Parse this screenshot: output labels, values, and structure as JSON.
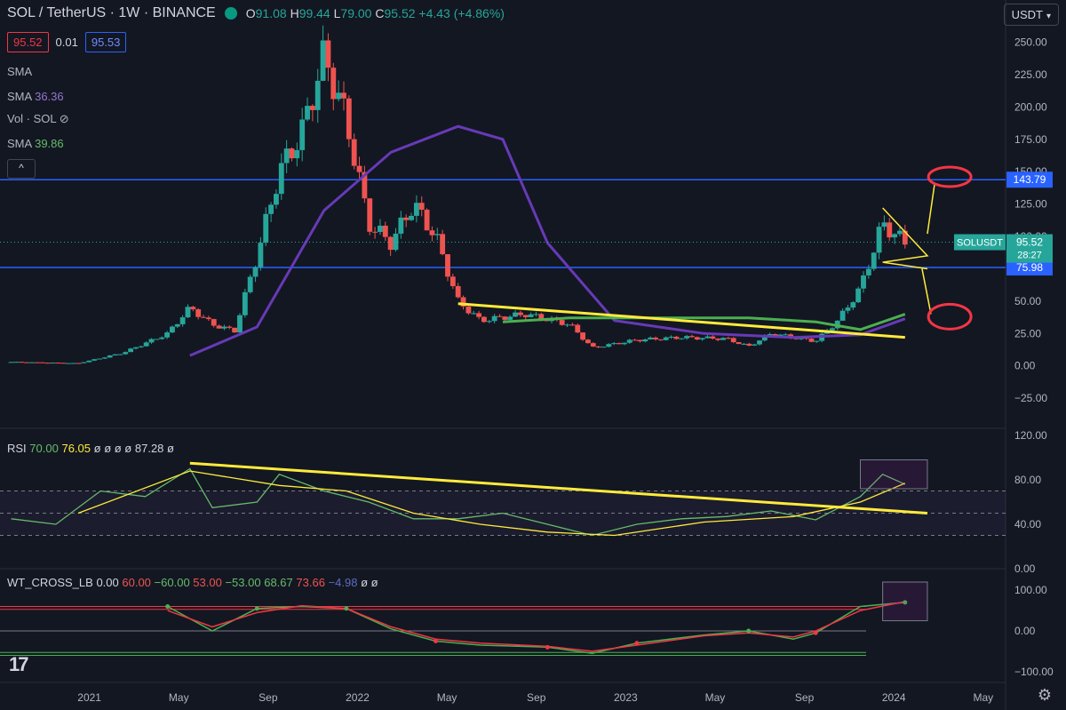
{
  "header": {
    "symbol": "SOL / TetherUS · 1W · BINANCE",
    "open_label": "O",
    "open": "91.08",
    "high_label": "H",
    "high": "99.44",
    "low_label": "L",
    "low": "79.00",
    "close_label": "C",
    "close": "95.52",
    "change": "+4.43 (+4.86%)"
  },
  "bid": "95.52",
  "spread": "0.01",
  "ask": "95.53",
  "currency": "USDT",
  "indicators": {
    "sma1_label": "SMA",
    "sma2_label": "SMA",
    "sma2_value": "36.36",
    "vol_label": "Vol · SOL",
    "sma3_label": "SMA",
    "sma3_value": "39.86",
    "collapse_glyph": "^"
  },
  "rsi_label": {
    "name": "RSI",
    "v1": "70.00",
    "v2": "76.05",
    "v3": "ø ø ø ø",
    "v4": "87.28",
    "v5": "ø"
  },
  "wt_label": {
    "name": "WT_CROSS_LB",
    "v1": "0.00",
    "v2": "60.00",
    "v3": "−60.00",
    "v4": "53.00",
    "v5": "−53.00",
    "v6": "68.67",
    "v7": "73.66",
    "v8": "−4.98",
    "v9": "ø ø"
  },
  "logo": "17",
  "colors": {
    "bg": "#131722",
    "up": "#26a69a",
    "down": "#ef5350",
    "level": "#2962ff",
    "sma_fast": "#673ab7",
    "sma_slow": "#4caf50",
    "trend": "#ffeb3b",
    "price_tag": "#26a69a"
  },
  "chart_data": [
    {
      "type": "candlestick",
      "title": "SOL / TetherUS · 1W · BINANCE",
      "y_ticks": [
        250,
        225,
        200,
        175,
        150,
        125,
        100,
        75,
        50,
        25,
        0,
        -25
      ],
      "y_tick_labels": [
        "250.00",
        "225.00",
        "200.00",
        "175.00",
        "150.00",
        "125.00",
        "100.00",
        "75.00",
        "50.00",
        "25.00",
        "0.00",
        "−25.00"
      ],
      "ylim": [
        -40,
        262
      ],
      "x_ticks": [
        "2021",
        "May",
        "Sep",
        "2022",
        "May",
        "Sep",
        "2023",
        "May",
        "Sep",
        "2024",
        "May"
      ],
      "x_range": [
        "2020-09",
        "2024-06"
      ],
      "price_points": [
        [
          "2020-09",
          3
        ],
        [
          "2020-12",
          2
        ],
        [
          "2021-02",
          10
        ],
        [
          "2021-04",
          25
        ],
        [
          "2021-05",
          45
        ],
        [
          "2021-06",
          32
        ],
        [
          "2021-07",
          27
        ],
        [
          "2021-08",
          85
        ],
        [
          "2021-09",
          150
        ],
        [
          "2021-10",
          180
        ],
        [
          "2021-11",
          240
        ],
        [
          "2021-12",
          190
        ],
        [
          "2022-01",
          110
        ],
        [
          "2022-02",
          95
        ],
        [
          "2022-03",
          125
        ],
        [
          "2022-04",
          100
        ],
        [
          "2022-05",
          50
        ],
        [
          "2022-06",
          35
        ],
        [
          "2022-08",
          40
        ],
        [
          "2022-10",
          32
        ],
        [
          "2022-11",
          14
        ],
        [
          "2023-01",
          20
        ],
        [
          "2023-03",
          22
        ],
        [
          "2023-05",
          21
        ],
        [
          "2023-06",
          15
        ],
        [
          "2023-07",
          25
        ],
        [
          "2023-09",
          19
        ],
        [
          "2023-10",
          35
        ],
        [
          "2023-11",
          60
        ],
        [
          "2023-12",
          110
        ],
        [
          "2024-01",
          95
        ]
      ],
      "sma_fast_points": [
        [
          "2021-05",
          8
        ],
        [
          "2021-08",
          30
        ],
        [
          "2021-11",
          120
        ],
        [
          "2022-02",
          165
        ],
        [
          "2022-05",
          185
        ],
        [
          "2022-07",
          175
        ],
        [
          "2022-09",
          95
        ],
        [
          "2022-12",
          35
        ],
        [
          "2023-04",
          25
        ],
        [
          "2023-08",
          22
        ],
        [
          "2023-11",
          24
        ],
        [
          "2024-01",
          36.36
        ]
      ],
      "sma_slow_points": [
        [
          "2022-07",
          34
        ],
        [
          "2022-10",
          37
        ],
        [
          "2023-03",
          37
        ],
        [
          "2023-06",
          37
        ],
        [
          "2023-09",
          34
        ],
        [
          "2023-11",
          28
        ],
        [
          "2024-01",
          39.86
        ]
      ],
      "levels": [
        {
          "value": 143.79,
          "label": "143.79"
        },
        {
          "value": 75.98,
          "label": "75.98"
        }
      ],
      "last_price": {
        "symbol": "SOLUSDT",
        "value": "95.52",
        "countdown": "28:27"
      }
    },
    {
      "type": "line",
      "title": "RSI",
      "y_ticks": [
        120,
        80,
        40,
        0
      ],
      "y_tick_labels": [
        "120.00",
        "80.00",
        "40.00",
        "0.00"
      ],
      "ylim": [
        0,
        120
      ],
      "bands": [
        70,
        50,
        30
      ],
      "rsi_points": [
        [
          "2020-09",
          45
        ],
        [
          "2020-11",
          40
        ],
        [
          "2021-01",
          70
        ],
        [
          "2021-03",
          65
        ],
        [
          "2021-05",
          90
        ],
        [
          "2021-06",
          55
        ],
        [
          "2021-08",
          60
        ],
        [
          "2021-09",
          85
        ],
        [
          "2021-11",
          70
        ],
        [
          "2022-01",
          60
        ],
        [
          "2022-03",
          45
        ],
        [
          "2022-05",
          45
        ],
        [
          "2022-07",
          50
        ],
        [
          "2022-09",
          40
        ],
        [
          "2022-11",
          30
        ],
        [
          "2023-01",
          40
        ],
        [
          "2023-03",
          45
        ],
        [
          "2023-05",
          47
        ],
        [
          "2023-07",
          52
        ],
        [
          "2023-09",
          44
        ],
        [
          "2023-11",
          65
        ],
        [
          "2023-12",
          85
        ],
        [
          "2024-01",
          76
        ]
      ],
      "rsi_ma_points": [
        [
          "2020-12",
          50
        ],
        [
          "2021-05",
          88
        ],
        [
          "2021-09",
          75
        ],
        [
          "2021-12",
          70
        ],
        [
          "2022-03",
          50
        ],
        [
          "2022-06",
          40
        ],
        [
          "2022-09",
          33
        ],
        [
          "2022-12",
          30
        ],
        [
          "2023-04",
          42
        ],
        [
          "2023-08",
          47
        ],
        [
          "2023-11",
          60
        ],
        [
          "2024-01",
          77
        ]
      ]
    },
    {
      "type": "line",
      "title": "WT_CROSS_LB",
      "y_ticks": [
        100,
        0,
        -100
      ],
      "y_tick_labels": [
        "100.00",
        "0.00",
        "−100.00"
      ],
      "ylim": [
        -120,
        120
      ],
      "bands": [
        60,
        53,
        -53,
        -60
      ],
      "wt1_points": [
        [
          "2021-04",
          60
        ],
        [
          "2021-06",
          0
        ],
        [
          "2021-08",
          55
        ],
        [
          "2021-10",
          60
        ],
        [
          "2021-12",
          55
        ],
        [
          "2022-02",
          5
        ],
        [
          "2022-04",
          -25
        ],
        [
          "2022-06",
          -35
        ],
        [
          "2022-09",
          -40
        ],
        [
          "2022-11",
          -55
        ],
        [
          "2023-01",
          -30
        ],
        [
          "2023-04",
          -10
        ],
        [
          "2023-06",
          0
        ],
        [
          "2023-08",
          -20
        ],
        [
          "2023-09",
          -5
        ],
        [
          "2023-11",
          60
        ],
        [
          "2024-01",
          70
        ]
      ],
      "wt2_points": [
        [
          "2021-04",
          50
        ],
        [
          "2021-06",
          10
        ],
        [
          "2021-08",
          45
        ],
        [
          "2021-10",
          62
        ],
        [
          "2021-12",
          55
        ],
        [
          "2022-02",
          10
        ],
        [
          "2022-04",
          -20
        ],
        [
          "2022-06",
          -30
        ],
        [
          "2022-09",
          -38
        ],
        [
          "2022-11",
          -50
        ],
        [
          "2023-01",
          -35
        ],
        [
          "2023-04",
          -12
        ],
        [
          "2023-06",
          -5
        ],
        [
          "2023-08",
          -15
        ],
        [
          "2023-09",
          0
        ],
        [
          "2023-11",
          50
        ],
        [
          "2024-01",
          72
        ]
      ]
    }
  ]
}
